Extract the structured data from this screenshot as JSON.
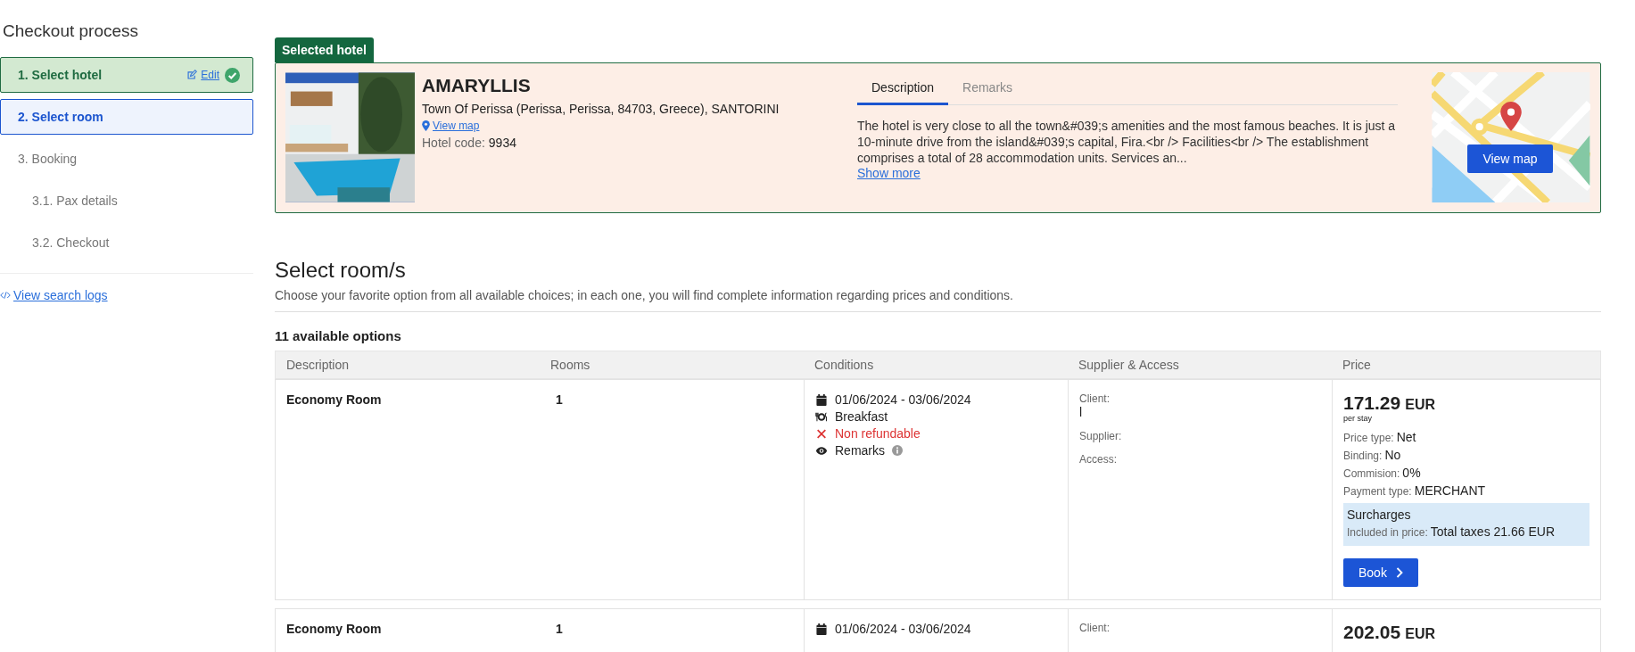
{
  "sidebar": {
    "title": "Checkout process",
    "steps": [
      {
        "label": "1. Select hotel",
        "done": true,
        "selected": false,
        "edit": "Edit"
      },
      {
        "label": "2. Select room",
        "done": false,
        "selected": true
      },
      {
        "label": "3. Booking",
        "done": false,
        "selected": false,
        "children": [
          {
            "label": "3.1. Pax details",
            "done": false,
            "selected": false
          },
          {
            "label": "3.2. Checkout",
            "done": false,
            "selected": false
          }
        ]
      }
    ],
    "logs_link": "View search logs"
  },
  "hotel": {
    "badge": "Selected hotel",
    "name": "AMARYLLIS",
    "address": "Town Of Perissa (Perissa, Perissa, 84703, Greece), SANTORINI",
    "map_link": "View map",
    "code_label": "Hotel code:",
    "code": "9934",
    "tabs": [
      {
        "label": "Description",
        "selected": true
      },
      {
        "label": "Remarks",
        "selected": false
      }
    ],
    "description": "The hotel is very close to all the town&#039;s amenities and the most famous beaches. It is just a 10-minute drive from the island&#039;s capital, Fira.<br /> Facilities<br /> The establishment comprises a total of 28 accommodation units. Services an...",
    "show_more": "Show more",
    "map_button": "View map"
  },
  "rooms": {
    "title": "Select room/s",
    "subtitle": "Choose your favorite option from all available choices; in each one, you will find complete information regarding prices and conditions.",
    "count": "11 available options",
    "columns": [
      "Description",
      "Rooms",
      "Conditions",
      "Supplier & Access",
      "Price"
    ],
    "rows": [
      {
        "description": "Economy Room",
        "rooms": "1",
        "conditions": [
          {
            "kind": "dates",
            "text": "01/06/2024 - 03/06/2024"
          },
          {
            "kind": "meal",
            "text": "Breakfast"
          },
          {
            "kind": "nonrefundable",
            "text": "Non refundable"
          },
          {
            "kind": "remarks",
            "text": "Remarks"
          }
        ],
        "supplier": [
          {
            "label": "Client:",
            "value": "l"
          },
          {
            "label": "Supplier:"
          },
          {
            "label": "Access:"
          }
        ],
        "price": "171.29",
        "currency": "EUR",
        "per": "per stay",
        "details": [
          {
            "label": "Price type:",
            "value": "Net"
          },
          {
            "label": "Binding:",
            "value": "No"
          },
          {
            "label": "Commision:",
            "value": "0%"
          },
          {
            "label": "Payment type:",
            "value": "MERCHANT"
          }
        ],
        "surcharges": {
          "title": "Surcharges",
          "label": "Included in price:",
          "value": "Total taxes 21.66 EUR"
        },
        "book": "Book"
      },
      {
        "description": "Economy Room",
        "rooms": "1",
        "conditions": [
          {
            "kind": "dates",
            "text": "01/06/2024 - 03/06/2024"
          }
        ],
        "supplier": [
          {
            "label": "Client:"
          }
        ],
        "price": "202.05",
        "currency": "EUR"
      }
    ]
  }
}
